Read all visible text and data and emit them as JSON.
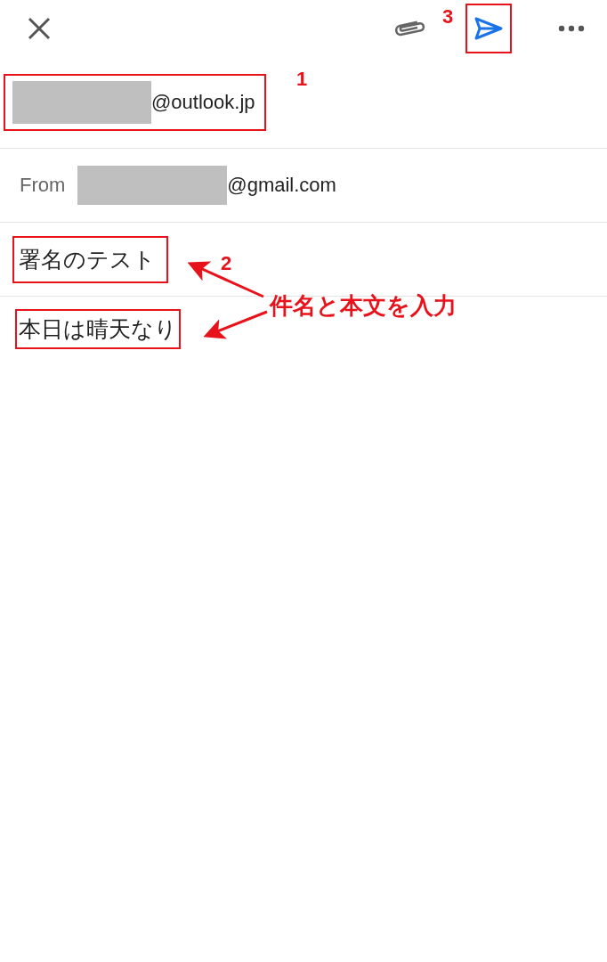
{
  "toolbar": {
    "send_highlighted": true,
    "send_step": "3"
  },
  "to": {
    "redacted": true,
    "value": "@outlook.jp",
    "step": "1"
  },
  "from": {
    "label": "From",
    "redacted": true,
    "value": "@gmail.com"
  },
  "subject": {
    "value": "署名のテスト",
    "highlighted": true,
    "step": "2"
  },
  "body": {
    "value": "本日は晴天なり",
    "highlighted": true
  },
  "callout": {
    "text": "件名と本文を入力"
  }
}
